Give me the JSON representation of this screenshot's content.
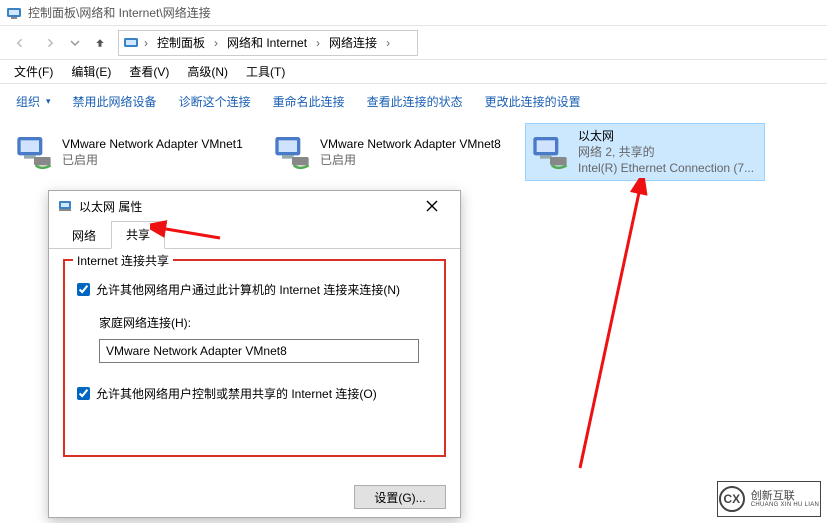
{
  "window": {
    "title_path": "控制面板\\网络和 Internet\\网络连接"
  },
  "breadcrumb": {
    "root": "控制面板",
    "mid": "网络和 Internet",
    "leaf": "网络连接"
  },
  "menu": {
    "file": "文件(F)",
    "edit": "编辑(E)",
    "view": "查看(V)",
    "advanced": "高级(N)",
    "tools": "工具(T)"
  },
  "toolbar": {
    "organize": "组织",
    "disable": "禁用此网络设备",
    "diagnose": "诊断这个连接",
    "rename": "重命名此连接",
    "status": "查看此连接的状态",
    "change": "更改此连接的设置"
  },
  "adapters": [
    {
      "name": "VMware Network Adapter VMnet1",
      "line2": "已启用",
      "line3": "",
      "selected": false
    },
    {
      "name": "VMware Network Adapter VMnet8",
      "line2": "已启用",
      "line3": "",
      "selected": false
    },
    {
      "name": "以太网",
      "line2": "网络 2, 共享的",
      "line3": "Intel(R) Ethernet Connection (7...",
      "selected": true
    }
  ],
  "dialog": {
    "title": "以太网 属性",
    "tabs": {
      "network": "网络",
      "sharing": "共享"
    },
    "group_title": "Internet 连接共享",
    "allow_connect": "允许其他网络用户通过此计算机的 Internet 连接来连接(N)",
    "home_label": "家庭网络连接(H):",
    "home_value": "VMware Network Adapter VMnet8",
    "allow_control": "允许其他网络用户控制或禁用共享的 Internet 连接(O)",
    "settings_btn": "设置(G)..."
  },
  "watermark": {
    "logo": "CX",
    "zh": "创新互联",
    "py": "CHUANG XIN HU LIAN"
  }
}
